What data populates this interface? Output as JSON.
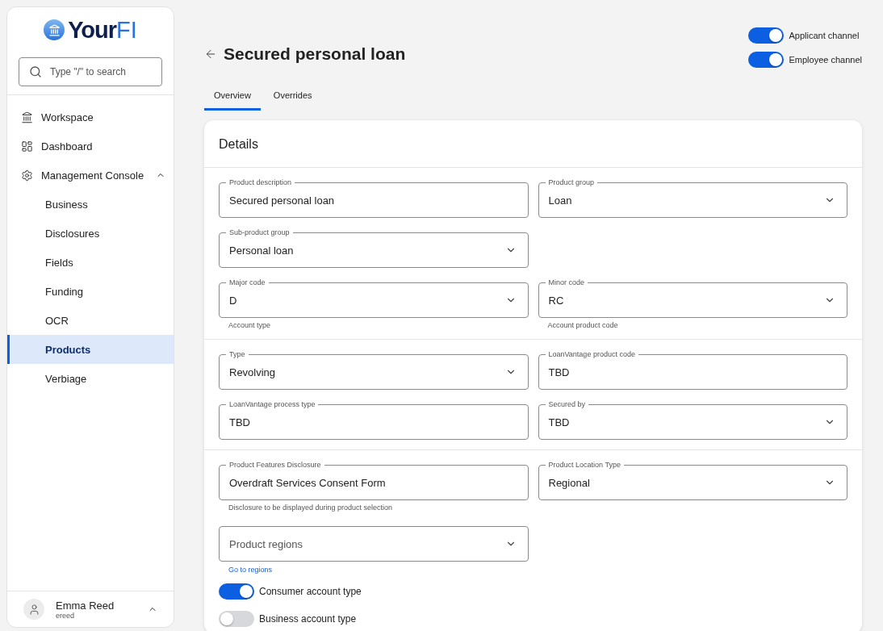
{
  "sidebar": {
    "logo": {
      "bold": "Your",
      "light": "FI"
    },
    "search": {
      "placeholder": "Type \"/\" to search"
    },
    "items": [
      {
        "label": "Workspace",
        "selected": false
      },
      {
        "label": "Dashboard",
        "selected": false
      },
      {
        "label": "Management Console",
        "selected": false,
        "expanded": true,
        "children": [
          {
            "label": "Business",
            "selected": false
          },
          {
            "label": "Disclosures",
            "selected": false
          },
          {
            "label": "Fields",
            "selected": false
          },
          {
            "label": "Funding",
            "selected": false
          },
          {
            "label": "OCR",
            "selected": false
          },
          {
            "label": "Products",
            "selected": true
          },
          {
            "label": "Verbiage",
            "selected": false
          }
        ]
      }
    ],
    "user": {
      "name": "Emma Reed",
      "username": "ereed",
      "expanded": true
    }
  },
  "page": {
    "title": "Secured personal loan",
    "channels": [
      {
        "label": "Applicant channel",
        "on": true
      },
      {
        "label": "Employee channel",
        "on": true
      }
    ],
    "tabs": [
      {
        "label": "Overview",
        "selected": true
      },
      {
        "label": "Overrides",
        "selected": false
      }
    ]
  },
  "details": {
    "title": "Details",
    "sections": [
      {
        "rows": [
          [
            {
              "kind": "text",
              "label": "Product description",
              "value": "Secured personal loan"
            },
            {
              "kind": "select",
              "label": "Product group",
              "value": "Loan"
            }
          ],
          [
            {
              "kind": "select",
              "label": "Sub-product group",
              "value": "Personal loan"
            }
          ],
          [
            {
              "kind": "select",
              "label": "Major code",
              "value": "D",
              "helper": "Account type"
            },
            {
              "kind": "select",
              "label": "Minor code",
              "value": "RC",
              "helper": "Account product code"
            }
          ]
        ]
      },
      {
        "rows": [
          [
            {
              "kind": "select",
              "label": "Type",
              "value": "Revolving"
            },
            {
              "kind": "text",
              "label": "LoanVantage product code",
              "value": "TBD"
            }
          ],
          [
            {
              "kind": "text",
              "label": "LoanVantage process type",
              "value": "TBD"
            },
            {
              "kind": "select",
              "label": "Secured by",
              "value": "TBD"
            }
          ]
        ]
      },
      {
        "rows": [
          [
            {
              "kind": "text",
              "label": "Product Features Disclosure",
              "value": "Overdraft Services Consent Form",
              "helper": "Disclosure to be displayed during product selection"
            },
            {
              "kind": "select",
              "label": "Product Location Type",
              "value": "Regional"
            }
          ],
          [
            {
              "kind": "select",
              "placeholder": "Product regions",
              "link": "Go to regions"
            }
          ]
        ]
      }
    ],
    "toggles": [
      {
        "label": "Consumer account type",
        "on": true
      },
      {
        "label": "Business account type",
        "on": false
      }
    ]
  }
}
